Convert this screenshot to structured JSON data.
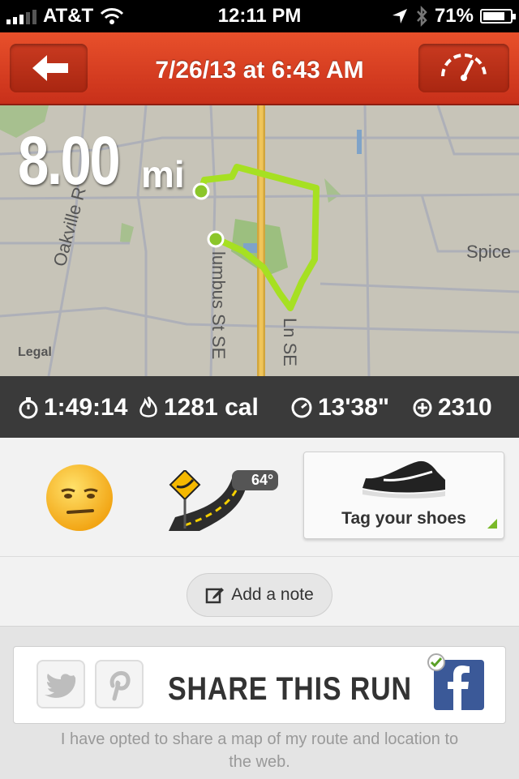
{
  "status_bar": {
    "carrier": "AT&T",
    "time": "12:11 PM",
    "battery": "71%",
    "battery_level": 0.71,
    "icons": [
      "signal-icon",
      "wifi-icon",
      "location-arrow-icon",
      "bluetooth-icon",
      "battery-icon"
    ]
  },
  "nav": {
    "title": "7/26/13 at 6:43 AM",
    "back_icon": "back-arrow-icon",
    "right_icon": "speedometer-icon",
    "accent": "#d9411f"
  },
  "map": {
    "distance_value": "8.00",
    "distance_unit": "mi",
    "street_labels": [
      "Oakville R",
      "Spice",
      "lumbus St SE",
      "Ln SE"
    ],
    "legal": "Legal",
    "route_color": "#a6e022"
  },
  "stats": {
    "duration": "1:49:14",
    "calories": "1281 cal",
    "pace": "13'38\"",
    "fuel": "2310"
  },
  "details": {
    "mood_icon": "unamused-face-icon",
    "terrain_icon": "road-icon",
    "weather_temp": "64°",
    "shoes_label": "Tag your shoes",
    "note_label": "Add a note"
  },
  "share": {
    "title": "SHARE THIS RUN",
    "note": "I have opted to share a map of my route and location to the web.",
    "services": [
      "twitter-icon",
      "pinterest-icon",
      "facebook-icon"
    ],
    "facebook_color": "#3b5998"
  }
}
